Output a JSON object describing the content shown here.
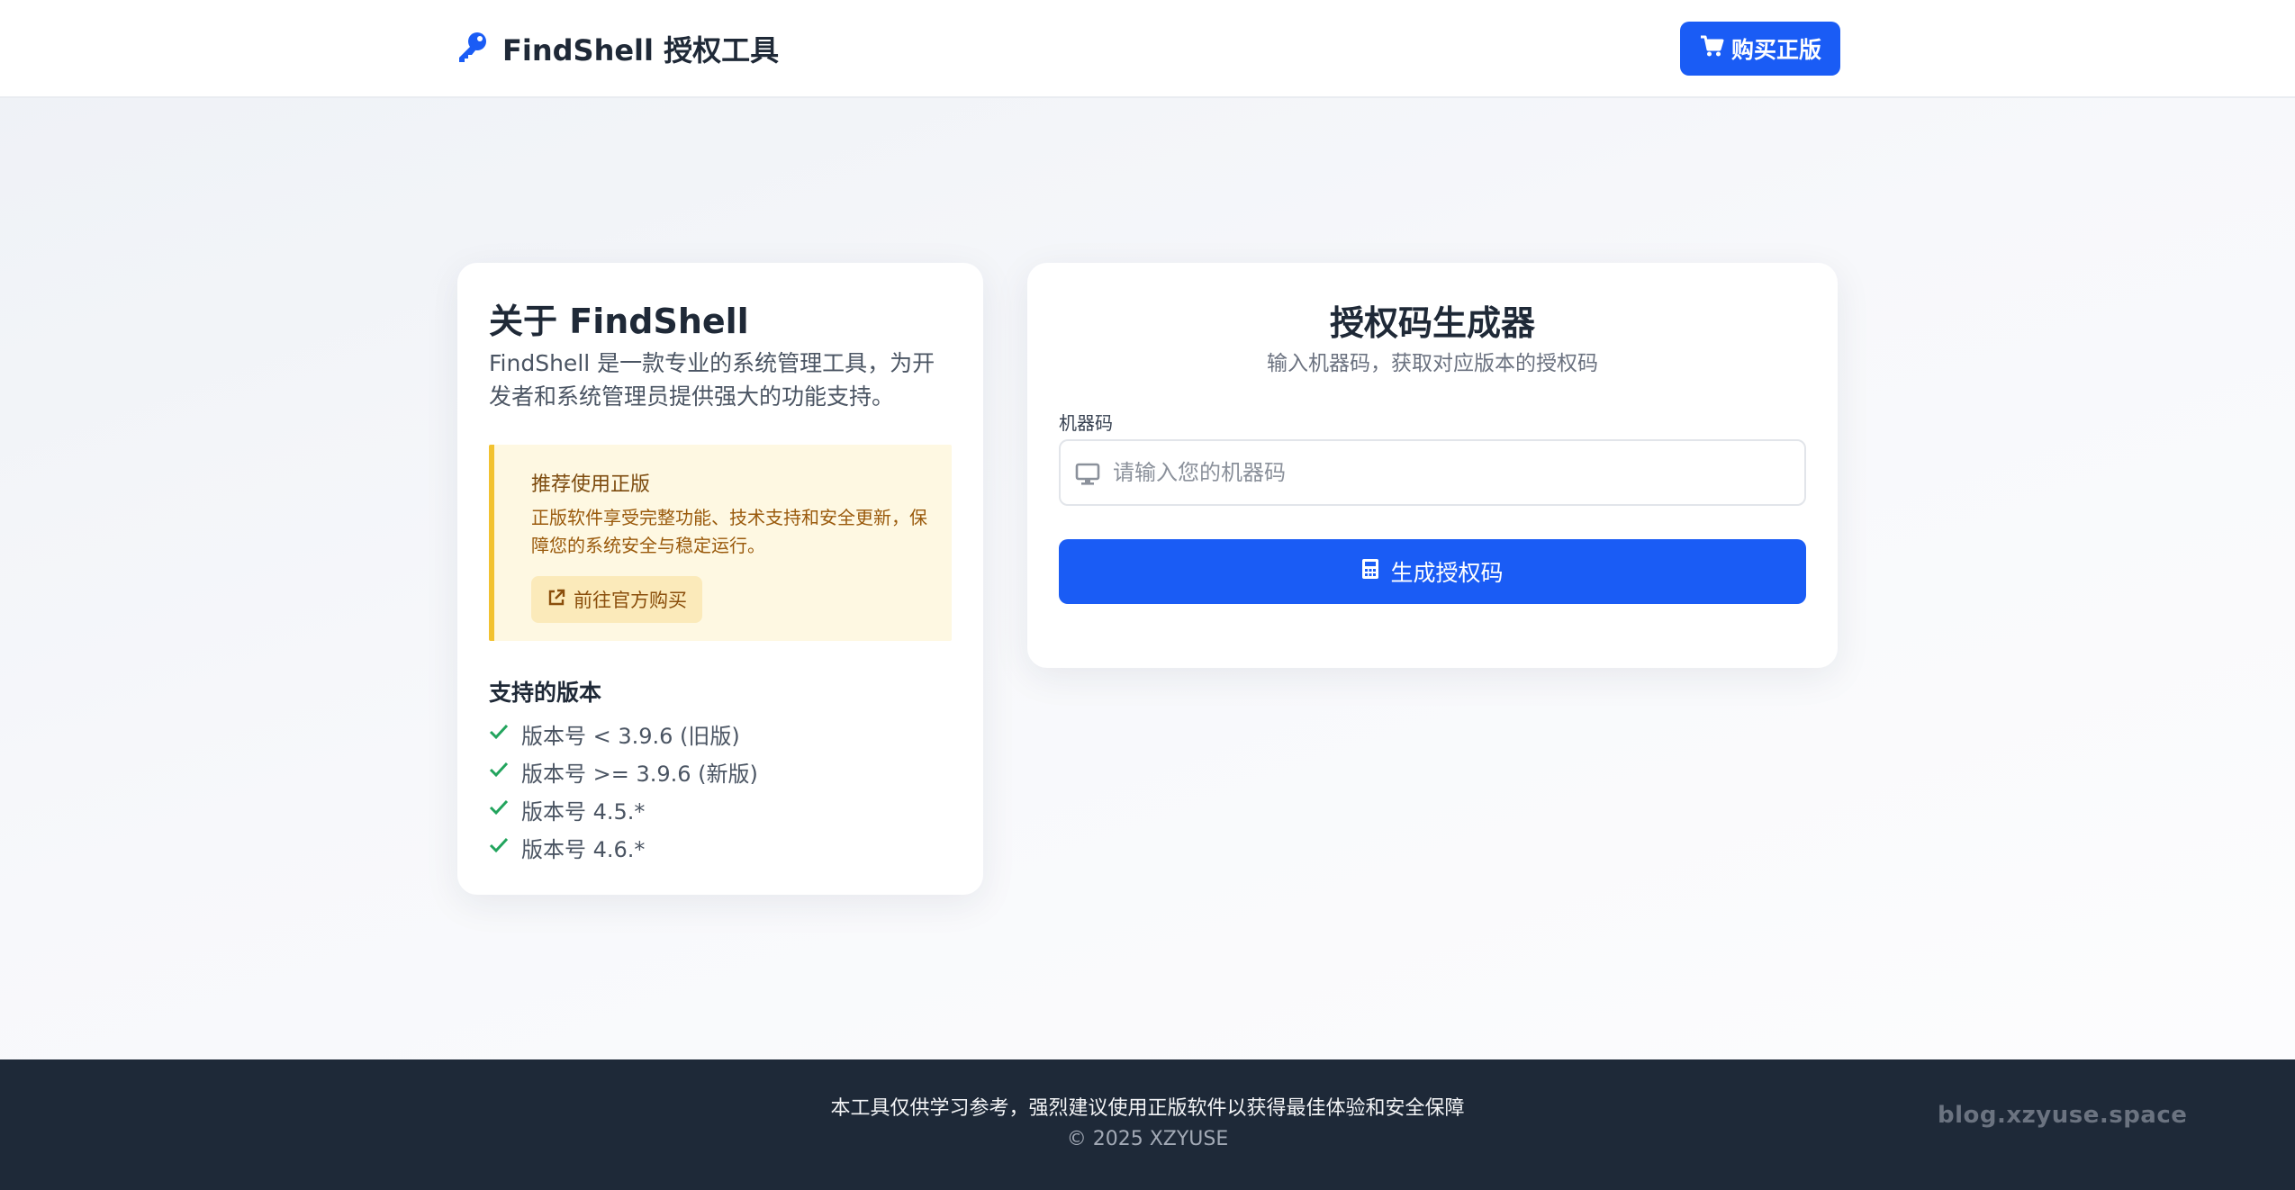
{
  "header": {
    "title": "FindShell 授权工具",
    "buy_label": "购买正版",
    "brand_icon": "key-icon",
    "buy_icon": "cart-icon"
  },
  "about": {
    "title": "关于 FindShell",
    "description": "FindShell 是一款专业的系统管理工具，为开发者和系统管理员提供强大的功能支持。",
    "notice": {
      "title": "推荐使用正版",
      "text": "正版软件享受完整功能、技术支持和安全更新，保障您的系统安全与稳定运行。",
      "link_label": "前往官方购买",
      "link_icon": "external-link-icon"
    },
    "versions_title": "支持的版本",
    "versions": [
      "版本号 < 3.9.6 (旧版)",
      "版本号 >= 3.9.6 (新版)",
      "版本号 4.5.*",
      "版本号 4.6.*"
    ]
  },
  "generator": {
    "title": "授权码生成器",
    "subtitle": "输入机器码，获取对应版本的授权码",
    "field_label": "机器码",
    "input_value": "",
    "input_placeholder": "请输入您的机器码",
    "input_icon": "monitor-icon",
    "button_label": "生成授权码",
    "button_icon": "calculator-icon"
  },
  "footer": {
    "note": "本工具仅供学习参考，强烈建议使用正版软件以获得最佳体验和安全保障",
    "copyright": "© 2025 XZYUSE",
    "watermark": "blog.xzyuse.space"
  },
  "colors": {
    "primary": "#1a5cf5",
    "success": "#22a45d",
    "warning_border": "#f2c230",
    "warning_bg": "#fef8e2",
    "footer_bg": "#1e2938"
  }
}
